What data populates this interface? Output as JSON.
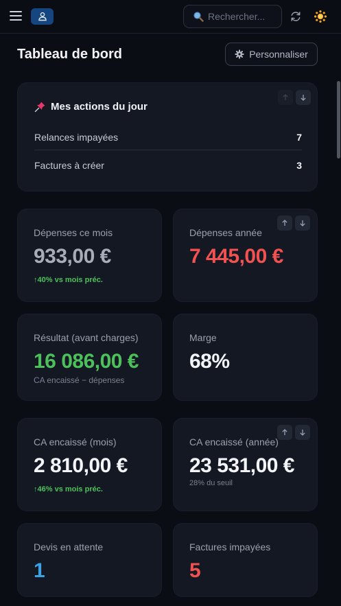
{
  "topbar": {
    "search_placeholder": "Rechercher...",
    "user_icon": "user-icon",
    "accent": "#154680"
  },
  "page": {
    "title": "Tableau de bord",
    "customize_label": "Personnaliser"
  },
  "actions": {
    "title": "Mes actions du jour",
    "items": [
      {
        "label": "Relances impayées",
        "count": "7"
      },
      {
        "label": "Factures à créer",
        "count": "3"
      }
    ]
  },
  "stats": {
    "depenses_mois": {
      "label": "Dépenses ce mois",
      "value": "933,00 €",
      "sub": "↑40% vs mois préc.",
      "color": "#a7acb8"
    },
    "depenses_annee": {
      "label": "Dépenses année",
      "value": "7 445,00 €",
      "color": "#f05252"
    },
    "resultat": {
      "label": "Résultat (avant charges)",
      "value": "16 086,00 €",
      "sub": "CA encaissé − dépenses",
      "color": "#4cc15b"
    },
    "marge": {
      "label": "Marge",
      "value": "68%",
      "color": "#f3f4f8"
    },
    "ca_mois": {
      "label": "CA encaissé (mois)",
      "value": "2 810,00 €",
      "sub": "↑46% vs mois préc.",
      "color": "#f3f4f8"
    },
    "ca_annee": {
      "label": "CA encaissé (année)",
      "value": "23 531,00 €",
      "sub": "28% du seuil",
      "color": "#f3f4f8"
    },
    "devis": {
      "label": "Devis en attente",
      "value": "1",
      "color": "#3aa3e6"
    },
    "factures_impayees": {
      "label": "Factures impayées",
      "value": "5",
      "color": "#f05252"
    }
  }
}
